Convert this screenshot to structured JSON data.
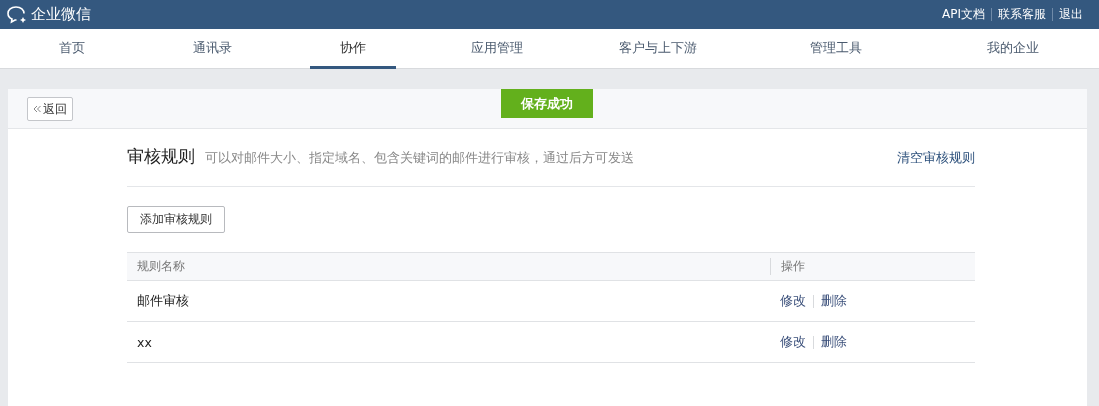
{
  "header": {
    "brand": "企业微信",
    "links": [
      {
        "label": "API文档"
      },
      {
        "label": "联系客服"
      },
      {
        "label": "退出"
      }
    ]
  },
  "tabs": [
    {
      "label": "首页",
      "selected": false
    },
    {
      "label": "通讯录",
      "selected": false
    },
    {
      "label": "协作",
      "selected": true
    },
    {
      "label": "应用管理",
      "selected": false
    },
    {
      "label": "客户与上下游",
      "selected": false
    },
    {
      "label": "管理工具",
      "selected": false
    },
    {
      "label": "我的企业",
      "selected": false
    }
  ],
  "back_button": "返回",
  "toast": "保存成功",
  "section": {
    "title": "审核规则",
    "description": "可以对邮件大小、指定域名、包含关键词的邮件进行审核，通过后方可发送",
    "clear_link": "清空审核规则"
  },
  "add_button": "添加审核规则",
  "table": {
    "columns": [
      "规则名称",
      "操作"
    ],
    "rows": [
      {
        "name": "邮件审核",
        "actions": [
          "修改",
          "删除"
        ]
      },
      {
        "name": "xx",
        "actions": [
          "修改",
          "删除"
        ]
      }
    ]
  }
}
